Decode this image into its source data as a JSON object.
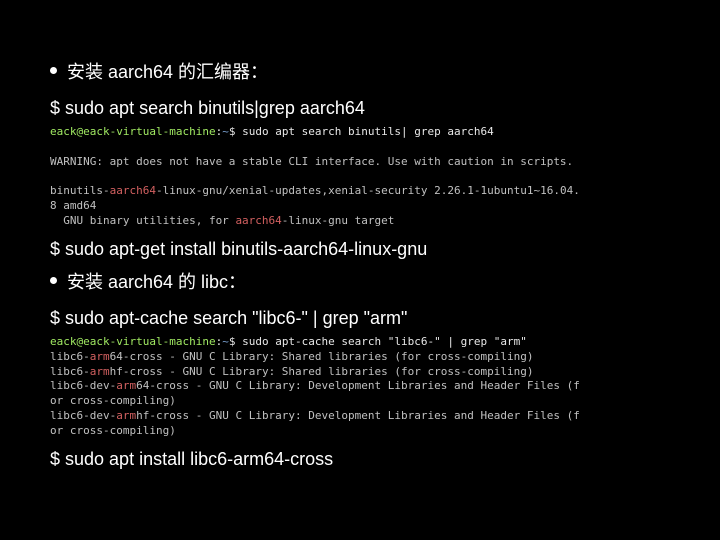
{
  "bullets": {
    "b1": "安装 aarch64 的汇编器：",
    "b2": "安装 aarch64 的 libc："
  },
  "commands": {
    "c1": "$ sudo apt search binutils|grep aarch64",
    "c2": "$ sudo apt-get install binutils-aarch64-linux-gnu",
    "c3": "$ sudo apt-cache search \"libc6-\" | grep \"arm\"",
    "c4": "$ sudo apt install libc6-arm64-cross"
  },
  "term1": {
    "user": "eack@eack-virtual-machine",
    "colon": ":",
    "path": "~",
    "prompt": "$ ",
    "cmd": "sudo apt search binutils| grep aarch64",
    "warn": "WARNING: apt does not have a stable CLI interface. Use with caution in scripts.",
    "l1a": "binutils-",
    "l1b": "aarch64",
    "l1c": "-linux-gnu/xenial-updates,xenial-security 2.26.1-1ubuntu1~16.04.",
    "l2": "8 amd64",
    "l3a": "  GNU binary utilities, for ",
    "l3b": "aarch64",
    "l3c": "-linux-gnu target"
  },
  "term2": {
    "user": "eack@eack-virtual-machine",
    "colon": ":",
    "path": "~",
    "prompt": "$ ",
    "cmd": "sudo apt-cache search \"libc6-\" | grep \"arm\"",
    "r1a": "libc6-",
    "r1b": "arm",
    "r1c": "64-cross - GNU C Library: Shared libraries (for cross-compiling)",
    "r2a": "libc6-",
    "r2b": "arm",
    "r2c": "hf-cross - GNU C Library: Shared libraries (for cross-compiling)",
    "r3a": "libc6-dev-",
    "r3b": "arm",
    "r3c": "64-cross - GNU C Library: Development Libraries and Header Files (f",
    "r4": "or cross-compiling)",
    "r5a": "libc6-dev-",
    "r5b": "arm",
    "r5c": "hf-cross - GNU C Library: Development Libraries and Header Files (f",
    "r6": "or cross-compiling)"
  }
}
